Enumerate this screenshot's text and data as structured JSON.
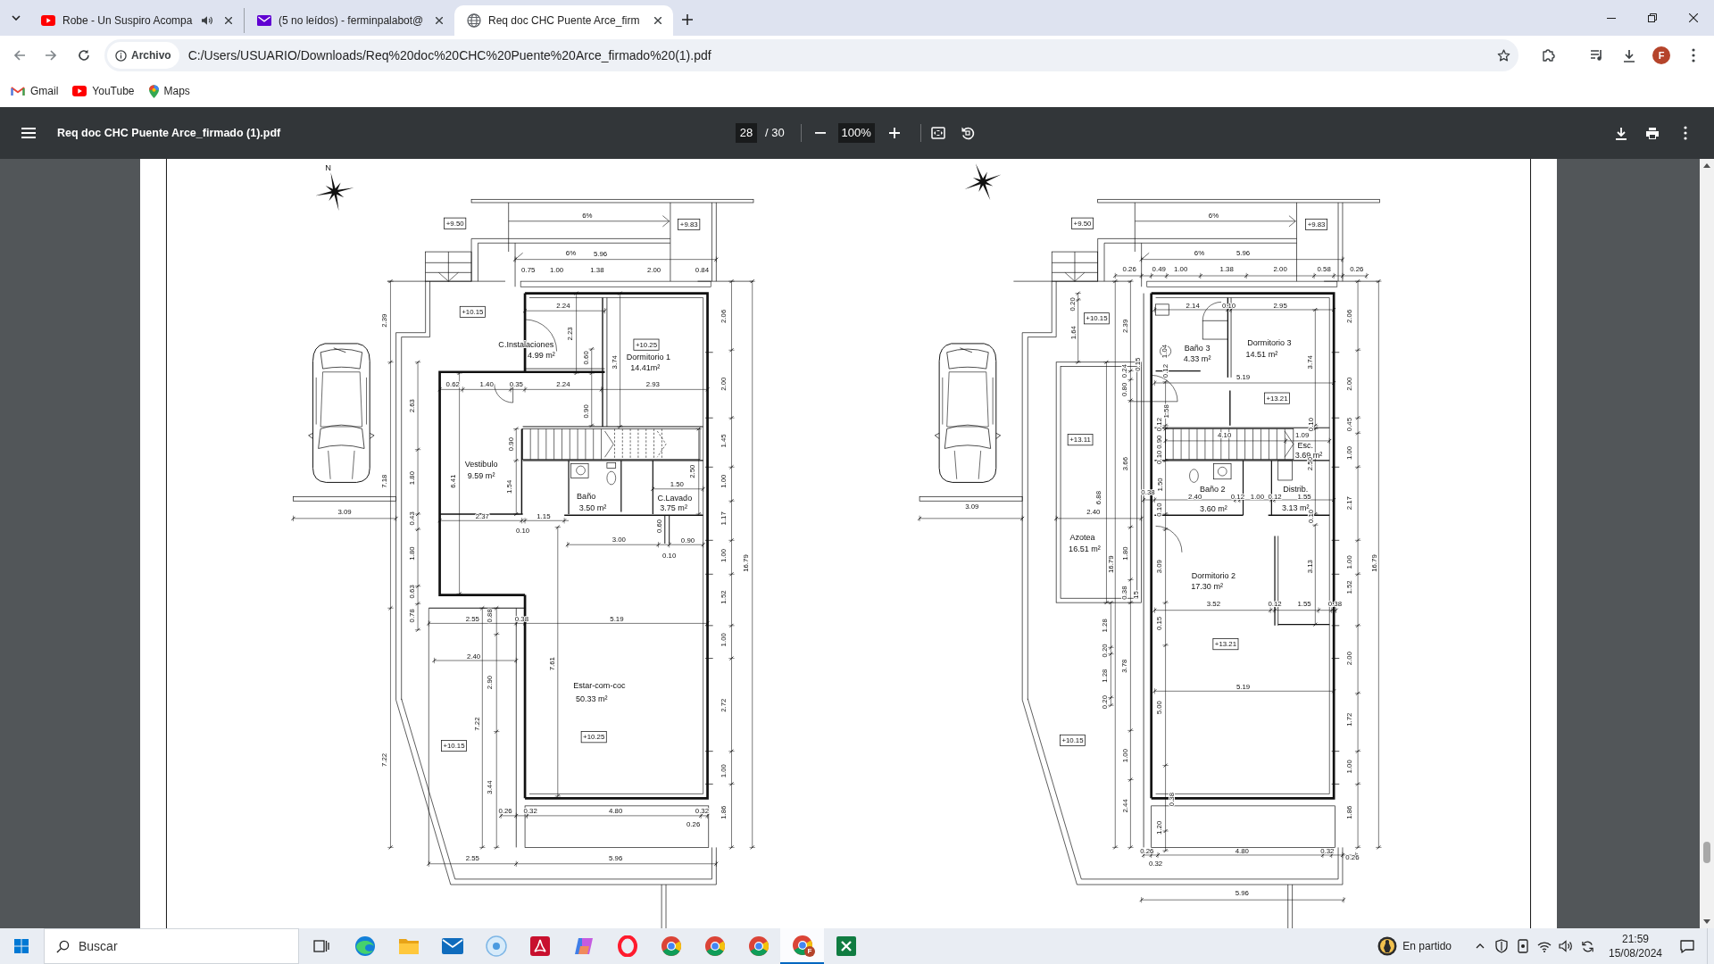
{
  "tabs": [
    {
      "title": "Robe - Un Suspiro Acompa",
      "selected": false,
      "audio": true
    },
    {
      "title": "(5 no leídos) - ferminpalabot@",
      "selected": false,
      "audio": false
    },
    {
      "title": "Req doc CHC Puente Arce_firm",
      "selected": true,
      "audio": false
    }
  ],
  "address_bar": {
    "chip": "Archivo",
    "url": "C:/Users/USUARIO/Downloads/Req%20doc%20CHC%20Puente%20Arce_firmado%20(1).pdf"
  },
  "profile_initial": "F",
  "bookmarks": [
    {
      "label": "Gmail"
    },
    {
      "label": "YouTube"
    },
    {
      "label": "Maps"
    }
  ],
  "pdf_toolbar": {
    "title": "Req doc CHC Puente Arce_firmado (1).pdf",
    "page": "28",
    "page_count": "/ 30",
    "zoom": "100%"
  },
  "plans": [
    {
      "labels": [
        {
          "kind": "north",
          "text": "N"
        },
        {
          "kind": "dimension",
          "text": "6%"
        },
        {
          "kind": "level",
          "text": "+9.50"
        },
        {
          "kind": "level",
          "text": "+9.83"
        },
        {
          "kind": "dimension",
          "text": "6%"
        },
        {
          "kind": "dimension",
          "text": "5.96"
        },
        {
          "kind": "dimension",
          "text": "0.75"
        },
        {
          "kind": "dimension",
          "text": "1.00"
        },
        {
          "kind": "dimension",
          "text": "1.38"
        },
        {
          "kind": "dimension",
          "text": "2.00"
        },
        {
          "kind": "dimension",
          "text": "0.84"
        },
        {
          "kind": "level",
          "text": "+10.15"
        },
        {
          "kind": "dimension",
          "text": "2.24"
        },
        {
          "kind": "dimension",
          "text": "2.39"
        },
        {
          "kind": "dimension",
          "text": "2.23"
        },
        {
          "kind": "dimension",
          "text": "2.06"
        },
        {
          "kind": "room",
          "text": "C.Instalaciones"
        },
        {
          "kind": "area",
          "text": "4.99 m²"
        },
        {
          "kind": "level",
          "text": "+10.25"
        },
        {
          "kind": "room",
          "text": "Dormitorio 1"
        },
        {
          "kind": "area",
          "text": "14.41m²"
        },
        {
          "kind": "dimension",
          "text": "0.60"
        },
        {
          "kind": "dimension",
          "text": "3.74"
        },
        {
          "kind": "dimension",
          "text": "0.62"
        },
        {
          "kind": "dimension",
          "text": "1.40"
        },
        {
          "kind": "dimension",
          "text": "0.35"
        },
        {
          "kind": "dimension",
          "text": "2.24"
        },
        {
          "kind": "dimension",
          "text": "2.93"
        },
        {
          "kind": "dimension",
          "text": "2.00"
        },
        {
          "kind": "dimension",
          "text": "2.63"
        },
        {
          "kind": "dimension",
          "text": "0.90"
        },
        {
          "kind": "dimension",
          "text": "0.90"
        },
        {
          "kind": "dimension",
          "text": "1.45"
        },
        {
          "kind": "room",
          "text": "Vestibulo"
        },
        {
          "kind": "area",
          "text": "9.59 m²"
        },
        {
          "kind": "dimension",
          "text": "6.41"
        },
        {
          "kind": "dimension",
          "text": "1.80"
        },
        {
          "kind": "dimension",
          "text": "7.18"
        },
        {
          "kind": "dimension",
          "text": "2.50"
        },
        {
          "kind": "dimension",
          "text": "1.54"
        },
        {
          "kind": "dimension",
          "text": "1.00"
        },
        {
          "kind": "dimension",
          "text": "1.50"
        },
        {
          "kind": "room",
          "text": "Baño"
        },
        {
          "kind": "area",
          "text": "3.50 m²"
        },
        {
          "kind": "room",
          "text": "C.Lavado"
        },
        {
          "kind": "area",
          "text": "3.75 m²"
        },
        {
          "kind": "dimension",
          "text": "3.09"
        },
        {
          "kind": "dimension",
          "text": "2.37"
        },
        {
          "kind": "dimension",
          "text": "1.15"
        },
        {
          "kind": "dimension",
          "text": "0.43"
        },
        {
          "kind": "dimension",
          "text": "1.17"
        },
        {
          "kind": "dimension",
          "text": "0.10"
        },
        {
          "kind": "dimension",
          "text": "3.00"
        },
        {
          "kind": "dimension",
          "text": "0.60"
        },
        {
          "kind": "dimension",
          "text": "0.90"
        },
        {
          "kind": "dimension",
          "text": "0.10"
        },
        {
          "kind": "dimension",
          "text": "1.80"
        },
        {
          "kind": "dimension",
          "text": "1.00"
        },
        {
          "kind": "dimension",
          "text": "16.79"
        },
        {
          "kind": "dimension",
          "text": "0.63"
        },
        {
          "kind": "dimension",
          "text": "1.52"
        },
        {
          "kind": "dimension",
          "text": "0.78"
        },
        {
          "kind": "dimension",
          "text": "2.55"
        },
        {
          "kind": "dimension",
          "text": "0.88"
        },
        {
          "kind": "dimension",
          "text": "0.38"
        },
        {
          "kind": "dimension",
          "text": "5.19"
        },
        {
          "kind": "dimension",
          "text": "1.00"
        },
        {
          "kind": "dimension",
          "text": "2.40"
        },
        {
          "kind": "dimension",
          "text": "2.90"
        },
        {
          "kind": "dimension",
          "text": "7.61"
        },
        {
          "kind": "room",
          "text": "Estar-com-coc"
        },
        {
          "kind": "area",
          "text": "50.33 m²"
        },
        {
          "kind": "dimension",
          "text": "2.72"
        },
        {
          "kind": "dimension",
          "text": "7.22"
        },
        {
          "kind": "level",
          "text": "+10.25"
        },
        {
          "kind": "level",
          "text": "+10.15"
        },
        {
          "kind": "dimension",
          "text": "7.22"
        },
        {
          "kind": "dimension",
          "text": "1.00"
        },
        {
          "kind": "dimension",
          "text": "3.44"
        },
        {
          "kind": "dimension",
          "text": "0.26"
        },
        {
          "kind": "dimension",
          "text": "0.32"
        },
        {
          "kind": "dimension",
          "text": "4.80"
        },
        {
          "kind": "dimension",
          "text": "0.32"
        },
        {
          "kind": "dimension",
          "text": "1.86"
        },
        {
          "kind": "dimension",
          "text": "0.26"
        },
        {
          "kind": "dimension",
          "text": "2.55"
        },
        {
          "kind": "dimension",
          "text": "5.96"
        }
      ]
    },
    {
      "labels": [
        {
          "kind": "dimension",
          "text": "6%"
        },
        {
          "kind": "level",
          "text": "+9.50"
        },
        {
          "kind": "level",
          "text": "+9.83"
        },
        {
          "kind": "dimension",
          "text": "6%"
        },
        {
          "kind": "dimension",
          "text": "5.96"
        },
        {
          "kind": "dimension",
          "text": "0.26"
        },
        {
          "kind": "dimension",
          "text": "0.49"
        },
        {
          "kind": "dimension",
          "text": "1.00"
        },
        {
          "kind": "dimension",
          "text": "1.38"
        },
        {
          "kind": "dimension",
          "text": "2.00"
        },
        {
          "kind": "dimension",
          "text": "0.58"
        },
        {
          "kind": "dimension",
          "text": "0.26"
        },
        {
          "kind": "dimension",
          "text": "0.20"
        },
        {
          "kind": "dimension",
          "text": "2.14"
        },
        {
          "kind": "dimension",
          "text": "0.10"
        },
        {
          "kind": "dimension",
          "text": "2.95"
        },
        {
          "kind": "level",
          "text": "+10.15"
        },
        {
          "kind": "dimension",
          "text": "2.06"
        },
        {
          "kind": "dimension",
          "text": "1.64"
        },
        {
          "kind": "dimension",
          "text": "2.39"
        },
        {
          "kind": "room",
          "text": "Baño 3"
        },
        {
          "kind": "area",
          "text": "4.33 m²"
        },
        {
          "kind": "dimension",
          "text": "1.04"
        },
        {
          "kind": "room",
          "text": "Dormitorio 3"
        },
        {
          "kind": "area",
          "text": "14.51 m²"
        },
        {
          "kind": "dimension",
          "text": "3.74"
        },
        {
          "kind": "dimension",
          "text": "0.15"
        },
        {
          "kind": "dimension",
          "text": "0.24"
        },
        {
          "kind": "dimension",
          "text": "0.12"
        },
        {
          "kind": "dimension",
          "text": "5.19"
        },
        {
          "kind": "dimension",
          "text": "2.00"
        },
        {
          "kind": "dimension",
          "text": "0.80"
        },
        {
          "kind": "level",
          "text": "+13.21"
        },
        {
          "kind": "dimension",
          "text": "1.58"
        },
        {
          "kind": "dimension",
          "text": "0.12"
        },
        {
          "kind": "dimension",
          "text": "0.10"
        },
        {
          "kind": "dimension",
          "text": "0.45"
        },
        {
          "kind": "dimension",
          "text": "4.10"
        },
        {
          "kind": "dimension",
          "text": "1.09"
        },
        {
          "kind": "dimension",
          "text": "0.90"
        },
        {
          "kind": "room",
          "text": "Esc."
        },
        {
          "kind": "area",
          "text": "3.69 m²"
        },
        {
          "kind": "level",
          "text": "+13.11"
        },
        {
          "kind": "dimension",
          "text": "1.00"
        },
        {
          "kind": "dimension",
          "text": "0.10"
        },
        {
          "kind": "dimension",
          "text": "3.66"
        },
        {
          "kind": "dimension",
          "text": "2.50"
        },
        {
          "kind": "dimension",
          "text": "1.50"
        },
        {
          "kind": "room",
          "text": "Baño 2"
        },
        {
          "kind": "room",
          "text": "Distrib."
        },
        {
          "kind": "dimension",
          "text": "0.38"
        },
        {
          "kind": "dimension",
          "text": "2.40"
        },
        {
          "kind": "dimension",
          "text": "0.12"
        },
        {
          "kind": "dimension",
          "text": "1.00"
        },
        {
          "kind": "dimension",
          "text": "0.12"
        },
        {
          "kind": "dimension",
          "text": "1.55"
        },
        {
          "kind": "dimension",
          "text": "6.88"
        },
        {
          "kind": "dimension",
          "text": "2.17"
        },
        {
          "kind": "dimension",
          "text": "3.09"
        },
        {
          "kind": "area",
          "text": "3.60 m²"
        },
        {
          "kind": "area",
          "text": "3.13 m²"
        },
        {
          "kind": "dimension",
          "text": "0.10"
        },
        {
          "kind": "dimension",
          "text": "0.10"
        },
        {
          "kind": "dimension",
          "text": "2.40"
        },
        {
          "kind": "room",
          "text": "Azotea"
        },
        {
          "kind": "area",
          "text": "16.51 m²"
        },
        {
          "kind": "dimension",
          "text": "1.80"
        },
        {
          "kind": "dimension",
          "text": "16.79"
        },
        {
          "kind": "dimension",
          "text": "3.09"
        },
        {
          "kind": "room",
          "text": "Dormitorio 2"
        },
        {
          "kind": "area",
          "text": "17.30 m²"
        },
        {
          "kind": "dimension",
          "text": "3.13"
        },
        {
          "kind": "dimension",
          "text": "1.00"
        },
        {
          "kind": "dimension",
          "text": "16.79"
        },
        {
          "kind": "dimension",
          "text": "0.38"
        },
        {
          "kind": "dimension",
          "text": "15"
        },
        {
          "kind": "dimension",
          "text": "1.52"
        },
        {
          "kind": "dimension",
          "text": "3.52"
        },
        {
          "kind": "dimension",
          "text": "0.12"
        },
        {
          "kind": "dimension",
          "text": "1.55"
        },
        {
          "kind": "dimension",
          "text": "0.38"
        },
        {
          "kind": "dimension",
          "text": "0.15"
        },
        {
          "kind": "dimension",
          "text": "1.28"
        },
        {
          "kind": "level",
          "text": "+13.21"
        },
        {
          "kind": "dimension",
          "text": "0.20"
        },
        {
          "kind": "dimension",
          "text": "2.00"
        },
        {
          "kind": "dimension",
          "text": "3.78"
        },
        {
          "kind": "dimension",
          "text": "1.28"
        },
        {
          "kind": "dimension",
          "text": "5.19"
        },
        {
          "kind": "dimension",
          "text": "0.20"
        },
        {
          "kind": "dimension",
          "text": "5.00"
        },
        {
          "kind": "dimension",
          "text": "1.72"
        },
        {
          "kind": "level",
          "text": "+10.15"
        },
        {
          "kind": "dimension",
          "text": "1.00"
        },
        {
          "kind": "dimension",
          "text": "1.00"
        },
        {
          "kind": "dimension",
          "text": "0.38"
        },
        {
          "kind": "dimension",
          "text": "2.44"
        },
        {
          "kind": "dimension",
          "text": "1.86"
        },
        {
          "kind": "dimension",
          "text": "1.20"
        },
        {
          "kind": "dimension",
          "text": "0.26"
        },
        {
          "kind": "dimension",
          "text": "4.80"
        },
        {
          "kind": "dimension",
          "text": "0.32"
        },
        {
          "kind": "dimension",
          "text": "0.32"
        },
        {
          "kind": "dimension",
          "text": "0.26"
        },
        {
          "kind": "dimension",
          "text": "5.96"
        }
      ]
    }
  ],
  "taskbar": {
    "search": {
      "placeholder": "Buscar"
    },
    "apps": [
      {
        "selected": false
      },
      {
        "selected": false
      },
      {
        "selected": false
      },
      {
        "selected": false
      },
      {
        "selected": false
      },
      {
        "selected": false
      },
      {
        "selected": false
      },
      {
        "selected": false
      },
      {
        "selected": false
      },
      {
        "selected": false
      },
      {
        "selected": false
      },
      {
        "selected": true,
        "badge": "F"
      },
      {
        "selected": false
      }
    ],
    "widget": "En partido",
    "time": "21:59",
    "date": "15/08/2024"
  }
}
